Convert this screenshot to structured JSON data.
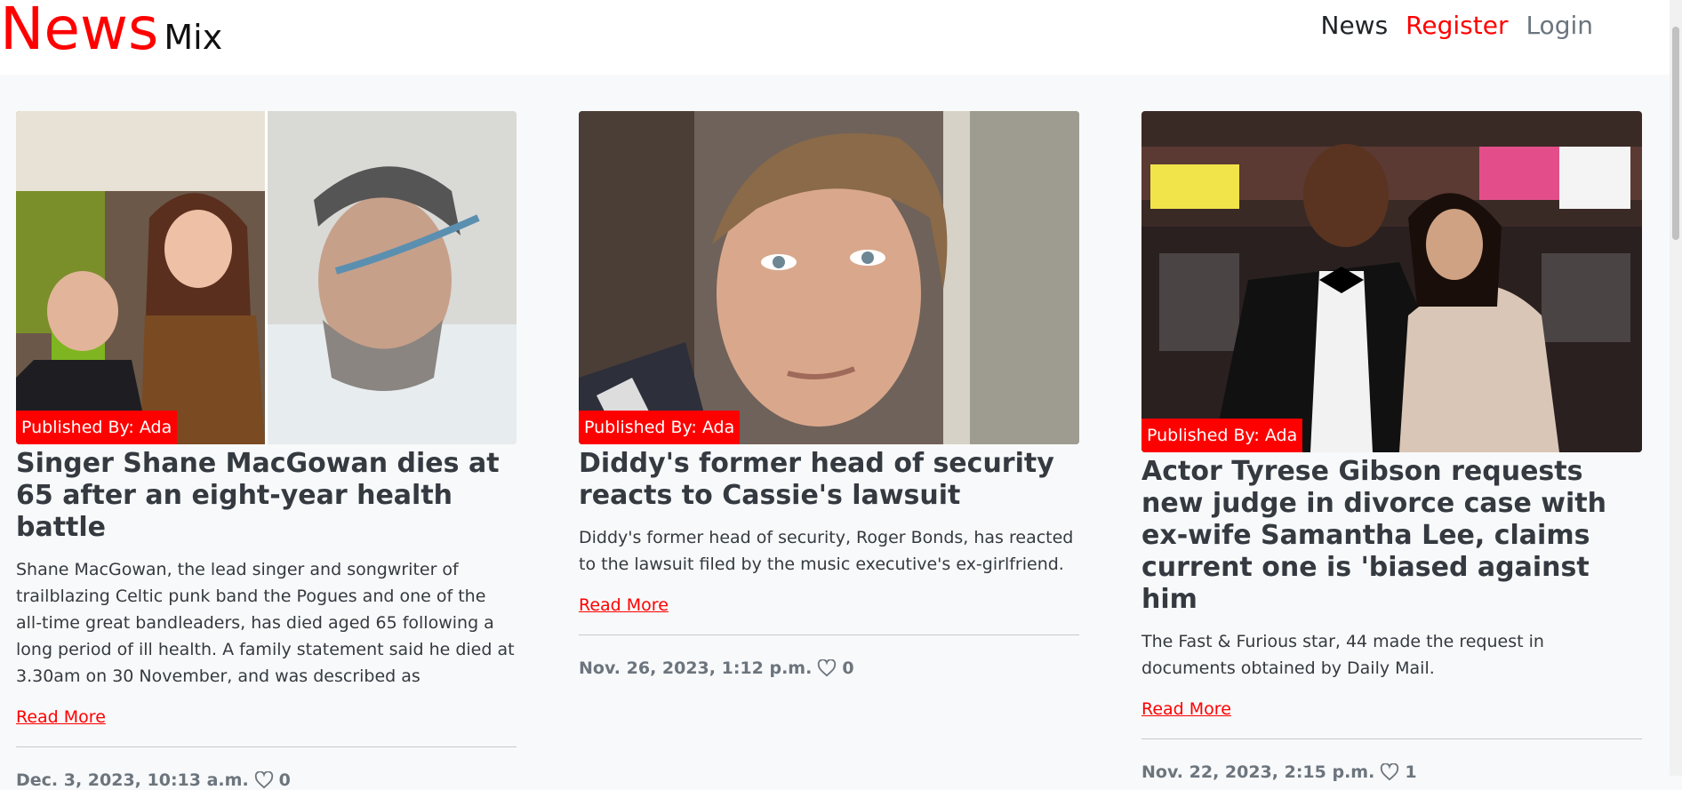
{
  "brand": {
    "primary": "News",
    "secondary": "Mix"
  },
  "nav": {
    "news": "News",
    "register": "Register",
    "login": "Login"
  },
  "colors": {
    "accent": "#ff0000",
    "text": "#343a40",
    "muted": "#6c757d",
    "background": "#f8f9fa"
  },
  "articles": [
    {
      "publisher": "Published By: Ada",
      "title": "Singer Shane MacGowan dies at 65 after an eight-year health battle",
      "description": "Shane MacGowan, the lead singer and songwriter of trailblazing Celtic punk band the Pogues and one of the all-time great bandleaders, has died aged 65 following a long period of ill health. A family statement said he died at 3.30am on 30 November, and was described as",
      "read_more": "Read More",
      "date": "Dec. 3, 2023, 10:13 a.m.",
      "likes": "0",
      "icon": "heart-icon"
    },
    {
      "publisher": "Published By: Ada",
      "title": "Diddy's former head of security reacts to Cassie's lawsuit",
      "description": "Diddy's former head of security, Roger Bonds, has reacted to the lawsuit filed by the music executive's ex-girlfriend.",
      "read_more": "Read More",
      "date": "Nov. 26, 2023, 1:12 p.m.",
      "likes": "0",
      "icon": "heart-icon"
    },
    {
      "publisher": "Published By: Ada",
      "title": "Actor Tyrese Gibson requests new judge in divorce case with ex-wife Samantha Lee, claims current one is 'biased against him",
      "description": "The Fast & Furious star, 44 made the request in documents obtained by Daily Mail.",
      "read_more": "Read More",
      "date": "Nov. 22, 2023, 2:15 p.m.",
      "likes": "1",
      "icon": "heart-icon"
    }
  ]
}
